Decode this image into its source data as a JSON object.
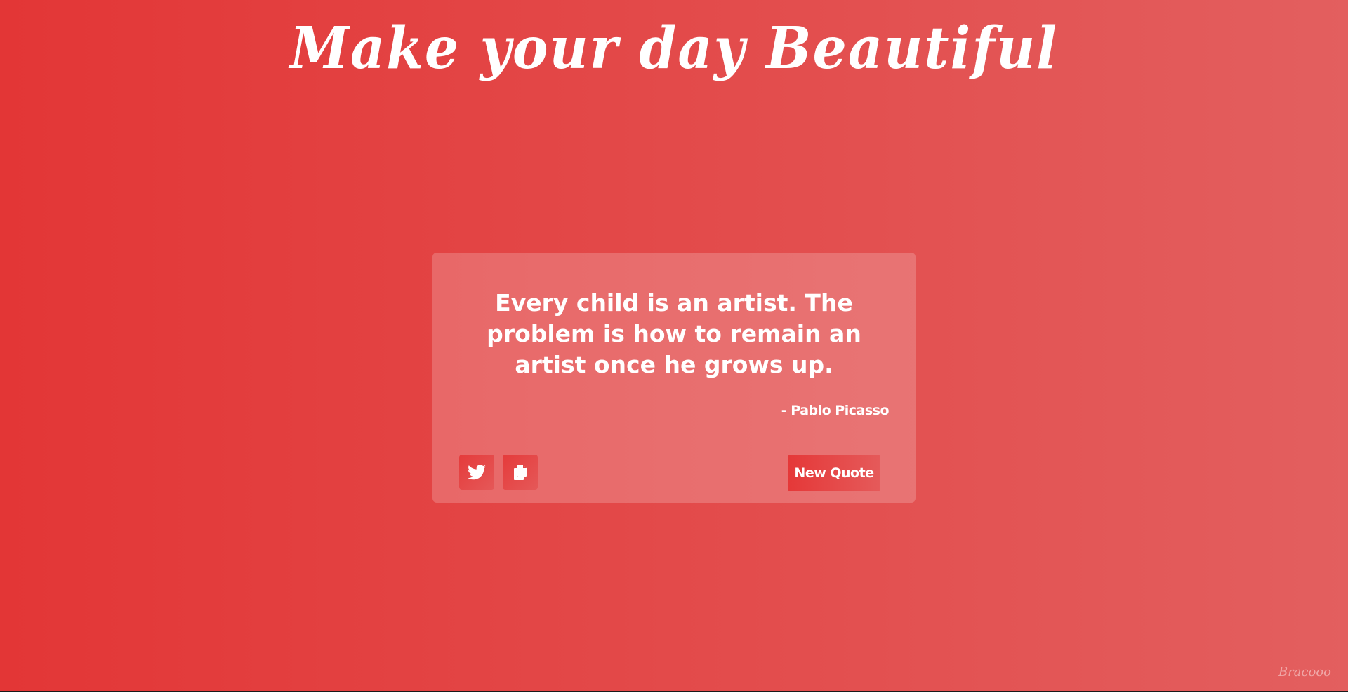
{
  "header": {
    "title": "Make your day Beautiful"
  },
  "quote": {
    "text": "Every child is an artist. The problem is how to remain an artist once he grows up.",
    "author": "- Pablo Picasso"
  },
  "actions": {
    "twitter_icon": "twitter-icon",
    "copy_icon": "copy-icon",
    "new_quote_label": "New Quote"
  },
  "footer": {
    "brand": "Bracooo"
  },
  "colors": {
    "background_start": "#e33636",
    "background_end": "#e35f5f",
    "text": "#ffffff"
  }
}
